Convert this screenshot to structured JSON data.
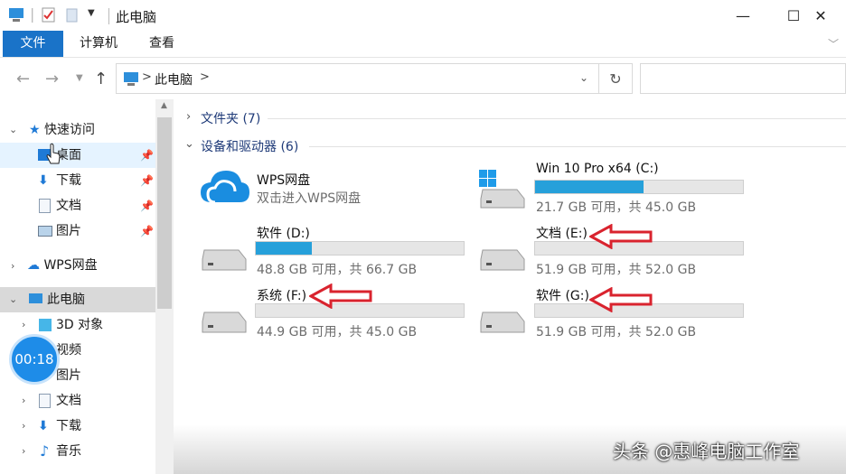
{
  "window": {
    "title": "此电脑",
    "min_glyph": "—",
    "max_glyph": "☐",
    "close_glyph": "✕"
  },
  "ribbon": {
    "tabs": [
      "文件",
      "计算机",
      "查看"
    ]
  },
  "address": {
    "path": "此电脑",
    "separator": ">"
  },
  "nav": {
    "quick_access": "快速访问",
    "quick_items": [
      "桌面",
      "下载",
      "文档",
      "图片"
    ],
    "wps": "WPS网盘",
    "this_pc": "此电脑",
    "pc_items": [
      "3D 对象",
      "视频",
      "图片",
      "文档",
      "下载",
      "音乐"
    ]
  },
  "content": {
    "folders_group": "文件夹 (7)",
    "drives_group": "设备和驱动器 (6)",
    "wps": {
      "name": "WPS网盘",
      "desc": "双击进入WPS网盘"
    },
    "drives": [
      {
        "name": "Win 10 Pro x64 (C:)",
        "space": "21.7 GB 可用，共 45.0 GB",
        "used_fraction": 0.52
      },
      {
        "name": "软件 (D:)",
        "space": "48.8 GB 可用，共 66.7 GB",
        "used_fraction": 0.27
      },
      {
        "name": "文档 (E:)",
        "space": "51.9 GB 可用，共 52.0 GB",
        "used_fraction": 0.0
      },
      {
        "name": "系统 (F:)",
        "space": "44.9 GB 可用，共 45.0 GB",
        "used_fraction": 0.0
      },
      {
        "name": "软件 (G:)",
        "space": "51.9 GB 可用，共 52.0 GB",
        "used_fraction": 0.0
      }
    ]
  },
  "overlay": {
    "timer": "00:18",
    "watermark": "头条 @惠峰电脑工作室"
  },
  "colors": {
    "accent": "#1a73c8",
    "bar_fill": "#26a0da",
    "arrow": "#d9232e"
  }
}
